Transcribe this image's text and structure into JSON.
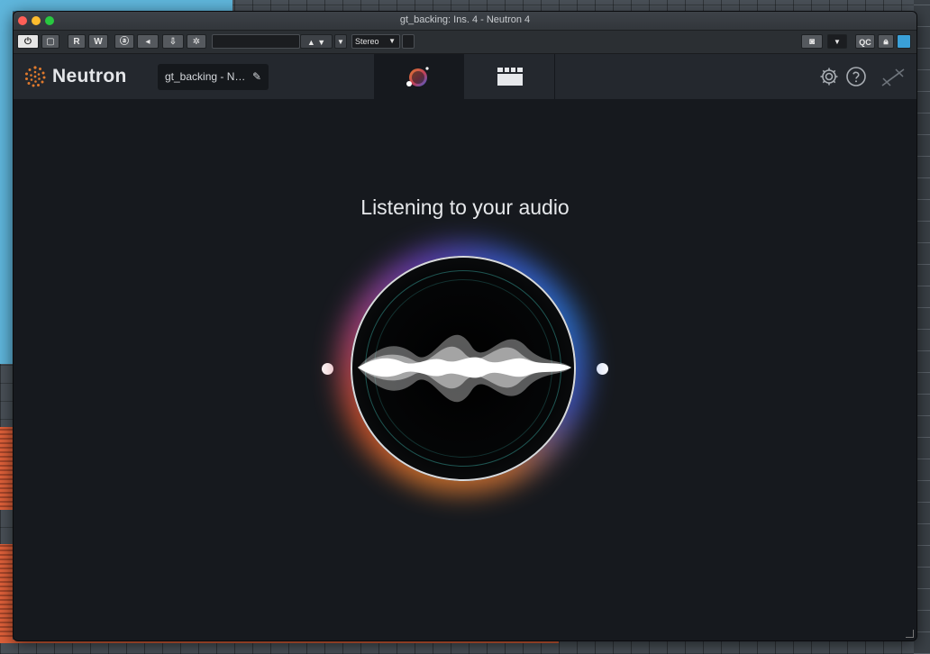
{
  "window": {
    "title": "gt_backing: Ins. 4 - Neutron 4"
  },
  "toolbar": {
    "read_label": "R",
    "write_label": "W",
    "preset_field_value": "",
    "channel_mode": "Stereo",
    "qc_label": "QC"
  },
  "header": {
    "logo_text": "Neutron",
    "preset_name": "gt_backing - N…",
    "tabs": [
      {
        "name": "Assistant",
        "active": true
      },
      {
        "name": "Mixer",
        "active": false
      }
    ]
  },
  "main": {
    "headline": "Listening to your audio"
  },
  "colors": {
    "accent_orange": "#e07a2d",
    "accent_blue": "#2e78e0",
    "panel_bg": "#16191e",
    "header_bg": "#24282e"
  },
  "icons": [
    "power-icon",
    "bypass-icon",
    "automation-icon",
    "arrow-left-icon",
    "routing-icon",
    "gear-icon",
    "camera-icon",
    "lock-icon",
    "settings-icon",
    "help-icon",
    "link-icon",
    "pencil-icon"
  ]
}
